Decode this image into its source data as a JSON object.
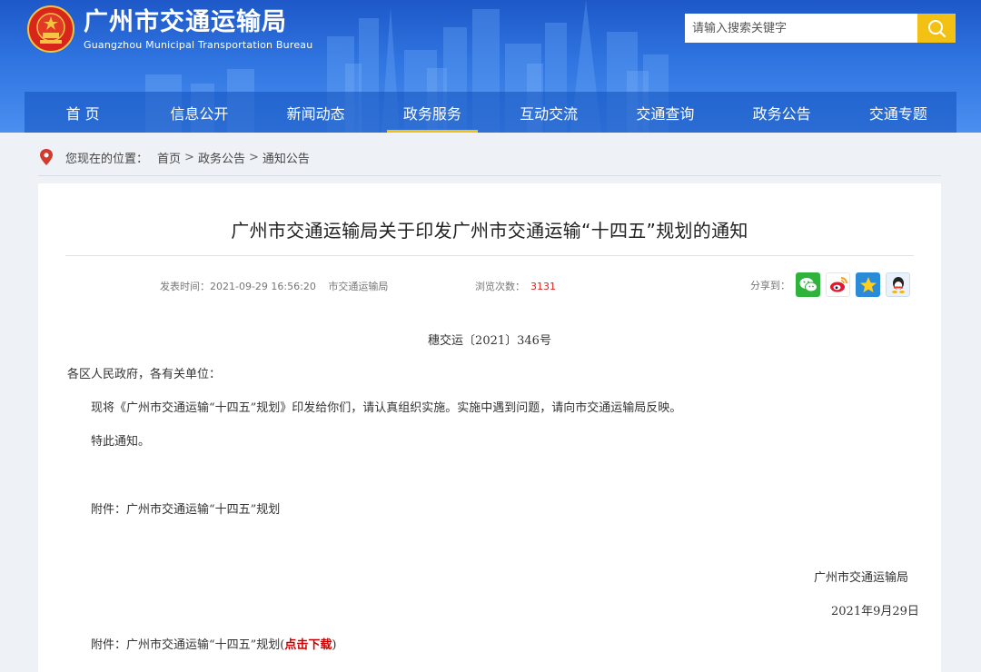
{
  "header": {
    "site_name": "广州市交通运输局",
    "site_name_en": "Guangzhou Municipal Transportation Bureau",
    "search_placeholder": "请输入搜索关键字"
  },
  "nav": {
    "items": [
      "首 页",
      "信息公开",
      "新闻动态",
      "政务服务",
      "互动交流",
      "交通查询",
      "政务公告",
      "交通专题"
    ],
    "active": "政务服务"
  },
  "breadcrumb": {
    "prefix": "您现在的位置：",
    "items": [
      "首页",
      "政务公告",
      "通知公告"
    ],
    "separator": ">"
  },
  "article": {
    "title": "广州市交通运输局关于印发广州市交通运输“十四五”规划的通知",
    "publish_label": "发表时间：",
    "publish_time": "2021-09-29 16:56:20",
    "source": "市交通运输局",
    "views_label": "浏览次数：",
    "views": "3131",
    "share_label": "分享到：",
    "share_icons": [
      "wechat-icon",
      "weibo-icon",
      "qzone-icon",
      "qq-icon"
    ],
    "doc_number": "穗交运〔2021〕346号",
    "salutation": "各区人民政府，各有关单位：",
    "body": "现将《广州市交通运输“十四五”规划》印发给你们，请认真组织实施。实施中遇到问题，请向市交通运输局反映。",
    "closing": "特此通知。",
    "attachment_line": "附件：广州市交通运输“十四五”规划",
    "signer": "广州市交通运输局",
    "date": "2021年9月29日",
    "attachment_download_prefix": "附件：广州市交通运输“十四五”规划(",
    "download_link": "点击下载",
    "attachment_download_suffix": ")"
  },
  "colors": {
    "banner": "#2f74e0",
    "accent": "#f2c114",
    "link_red": "#cc0000"
  }
}
